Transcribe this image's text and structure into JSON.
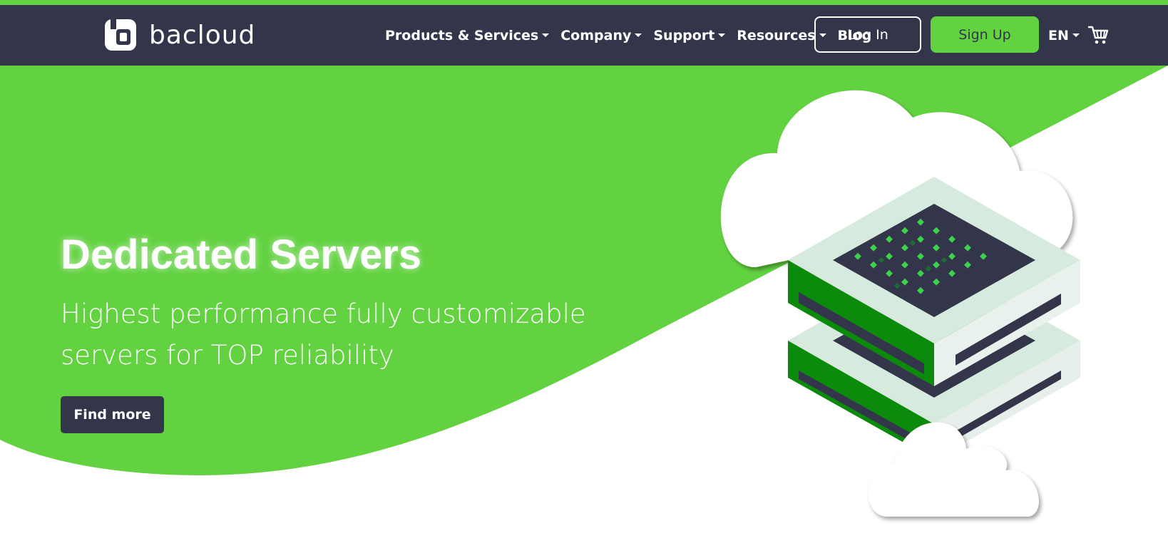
{
  "brand": {
    "name": "bacloud"
  },
  "nav": {
    "items": [
      {
        "label": "Products & Services",
        "dropdown": true
      },
      {
        "label": "Company",
        "dropdown": true
      },
      {
        "label": "Support",
        "dropdown": true
      },
      {
        "label": "Resources",
        "dropdown": true
      },
      {
        "label": "Blog",
        "dropdown": false
      }
    ],
    "login_label": "Log In",
    "signup_label": "Sign Up",
    "language": "EN",
    "cart_icon": "cart-icon"
  },
  "hero": {
    "title": "Dedicated Servers",
    "subtitle": "Highest performance fully customizable servers for TOP reliability",
    "cta_label": "Find more"
  },
  "colors": {
    "brand_green": "#62d241",
    "navbar_dark": "#33364a",
    "server_green": "#0b8a0b",
    "white": "#ffffff"
  }
}
